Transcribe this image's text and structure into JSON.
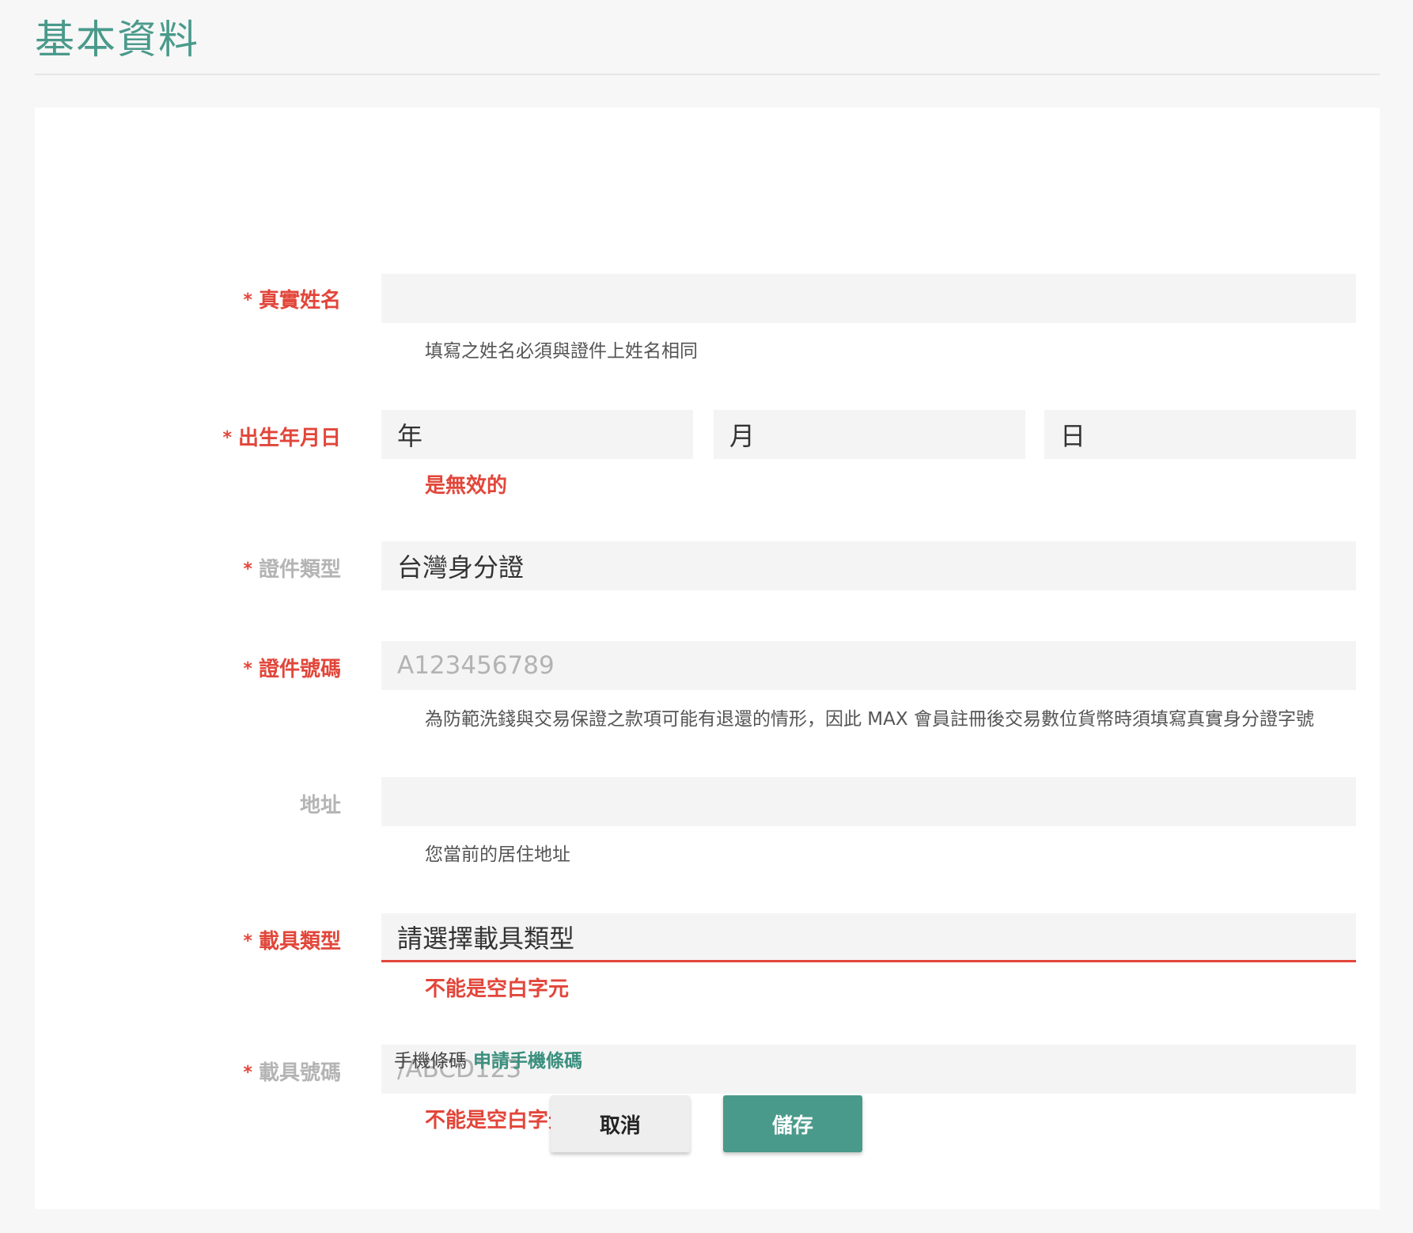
{
  "page": {
    "title": "基本資料"
  },
  "form": {
    "real_name": {
      "required_mark": "*",
      "label": "真實姓名",
      "value": "",
      "help": "填寫之姓名必須與證件上姓名相同"
    },
    "birthday": {
      "required_mark": "*",
      "label": "出生年月日",
      "year": "年",
      "month": "月",
      "day": "日",
      "error": "是無效的"
    },
    "id_type": {
      "required_mark": "*",
      "label": "證件類型",
      "value": "台灣身分證"
    },
    "id_number": {
      "required_mark": "*",
      "label": "證件號碼",
      "placeholder": "A123456789",
      "help": "為防範洗錢與交易保證之款項可能有退還的情形，因此 MAX 會員註冊後交易數位貨幣時須填寫真實身分證字號"
    },
    "address": {
      "label": "地址",
      "value": "",
      "help": "您當前的居住地址"
    },
    "carrier_type": {
      "required_mark": "*",
      "label": "載具類型",
      "value": "請選擇載具類型",
      "error": "不能是空白字元"
    },
    "carrier_number": {
      "required_mark": "*",
      "label": "載具號碼",
      "placeholder": "/ABCD123",
      "error": "不能是空白字元",
      "barcode_text": "手機條碼",
      "barcode_link": "申請手機條碼"
    }
  },
  "actions": {
    "cancel_label": "取消",
    "save_label": "儲存"
  },
  "colors": {
    "accent": "#4a9a8b",
    "error": "#e2463a",
    "field_bg": "#f4f4f4"
  }
}
